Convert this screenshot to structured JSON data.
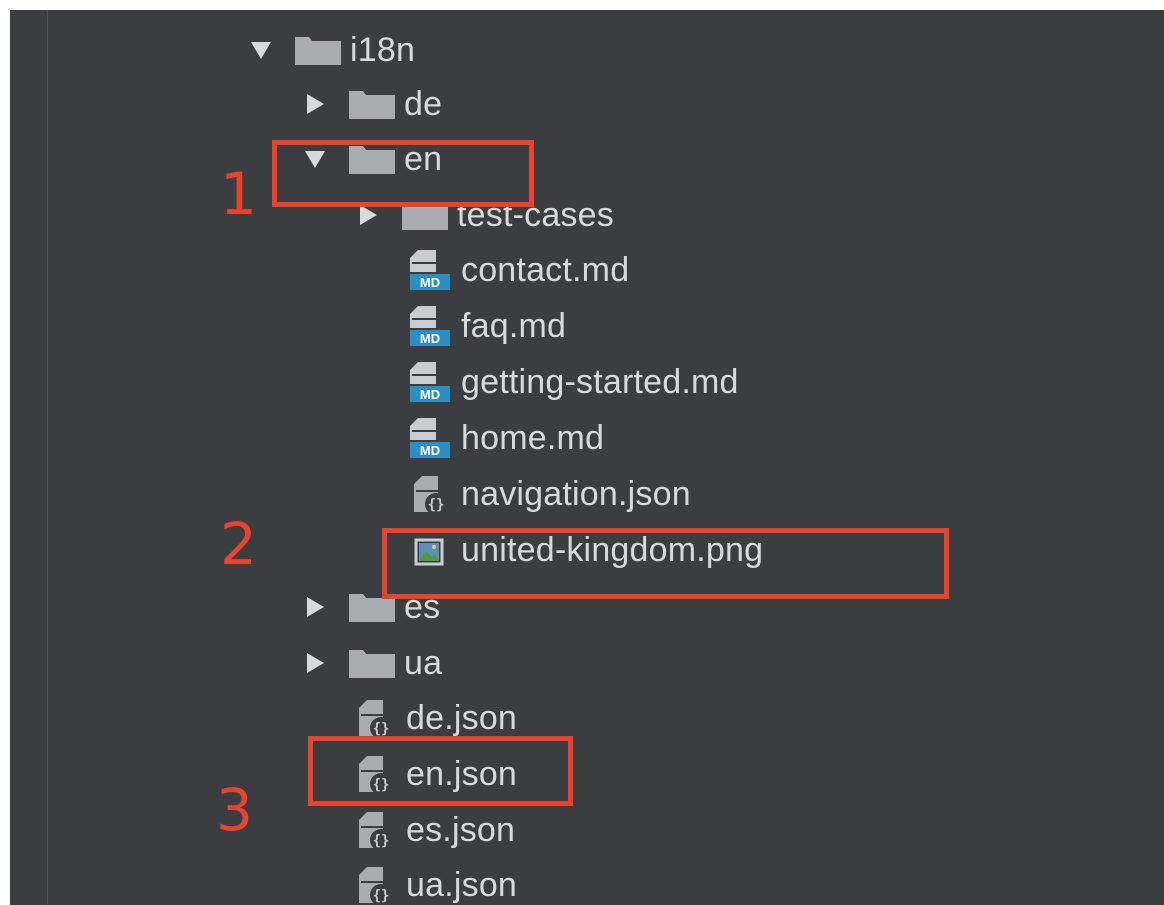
{
  "tree": {
    "rows": [
      {
        "label": "i18n",
        "type": "folder",
        "expanded": true
      },
      {
        "label": "de",
        "type": "folder",
        "expanded": false
      },
      {
        "label": "en",
        "type": "folder",
        "expanded": true
      },
      {
        "label": "test-cases",
        "type": "folder",
        "expanded": false
      },
      {
        "label": "contact.md",
        "type": "markdown",
        "badge": "MD"
      },
      {
        "label": "faq.md",
        "type": "markdown",
        "badge": "MD"
      },
      {
        "label": "getting-started.md",
        "type": "markdown",
        "badge": "MD"
      },
      {
        "label": "home.md",
        "type": "markdown",
        "badge": "MD"
      },
      {
        "label": "navigation.json",
        "type": "json"
      },
      {
        "label": "united-kingdom.png",
        "type": "image"
      },
      {
        "label": "es",
        "type": "folder",
        "expanded": false
      },
      {
        "label": "ua",
        "type": "folder",
        "expanded": false
      },
      {
        "label": "de.json",
        "type": "json"
      },
      {
        "label": "en.json",
        "type": "json"
      },
      {
        "label": "es.json",
        "type": "json"
      },
      {
        "label": "ua.json",
        "type": "json"
      }
    ]
  },
  "callouts": {
    "one": "1",
    "two": "2",
    "three": "3"
  },
  "colors": {
    "background": "#3b3d40",
    "text": "#d7dadd",
    "folder": "#a9adb2",
    "md_badge": "#2c8ec7",
    "callout": "#e8432e"
  }
}
